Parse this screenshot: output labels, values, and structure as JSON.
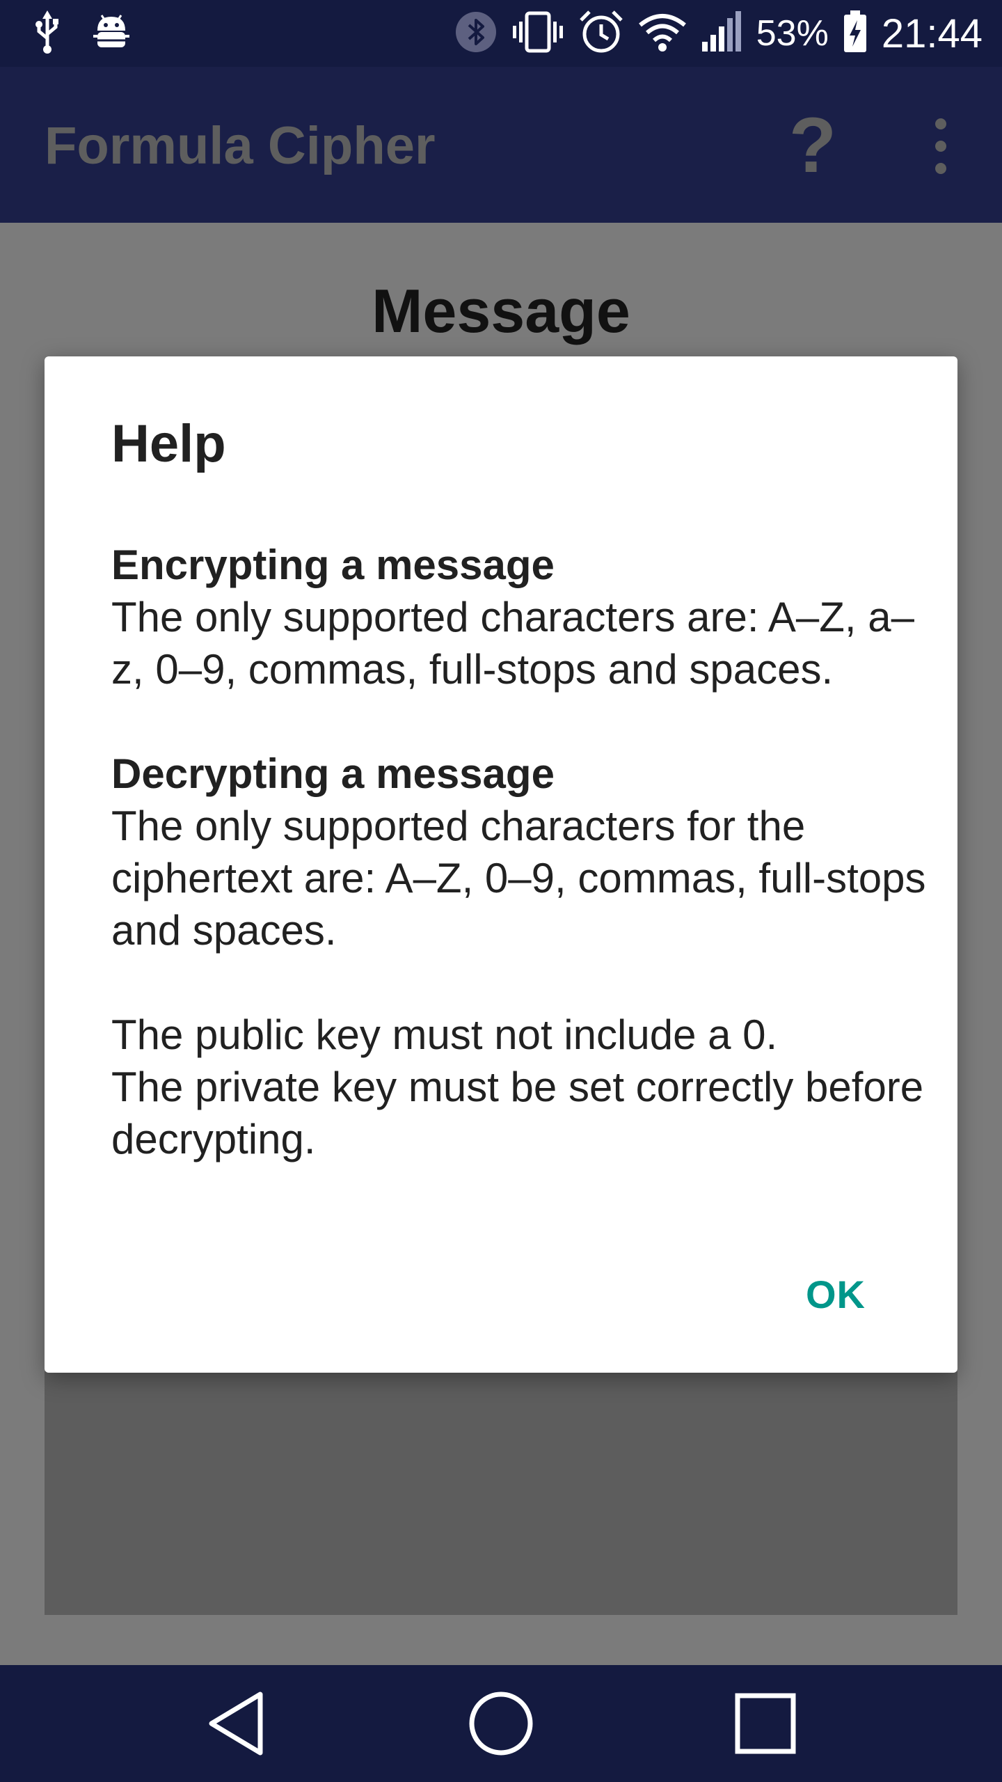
{
  "status_bar": {
    "battery_text": "53%",
    "time": "21:44",
    "icons": [
      "usb-icon",
      "android-debug-icon",
      "bluetooth-icon",
      "vibrate-icon",
      "alarm-icon",
      "wifi-icon",
      "signal-icon",
      "battery-charging-icon"
    ]
  },
  "app_bar": {
    "title": "Formula Cipher",
    "help_label": "?",
    "overflow_icon": "more-vert-icon"
  },
  "content": {
    "heading": "Message"
  },
  "dialog": {
    "title": "Help",
    "encrypt_heading": "Encrypting a message",
    "encrypt_text": "The only supported characters are: A–Z, a–z, 0–9, commas, full-stops and spaces.",
    "decrypt_heading": "Decrypting a message",
    "decrypt_text": "The only supported characters for the ciphertext are: A–Z, 0–9, commas, full-stops and spaces.",
    "keys_text_1": "The public key must not include a 0.",
    "keys_text_2": "The private key must be set correctly before decrypting.",
    "ok_label": "OK"
  },
  "nav_bar": {
    "icons": [
      "back-icon",
      "home-icon",
      "recents-icon"
    ]
  },
  "colors": {
    "status_bar": "#141a40",
    "app_bar": "#1a1f48",
    "accent": "#00968a",
    "scrim": "#7b7b7b"
  }
}
